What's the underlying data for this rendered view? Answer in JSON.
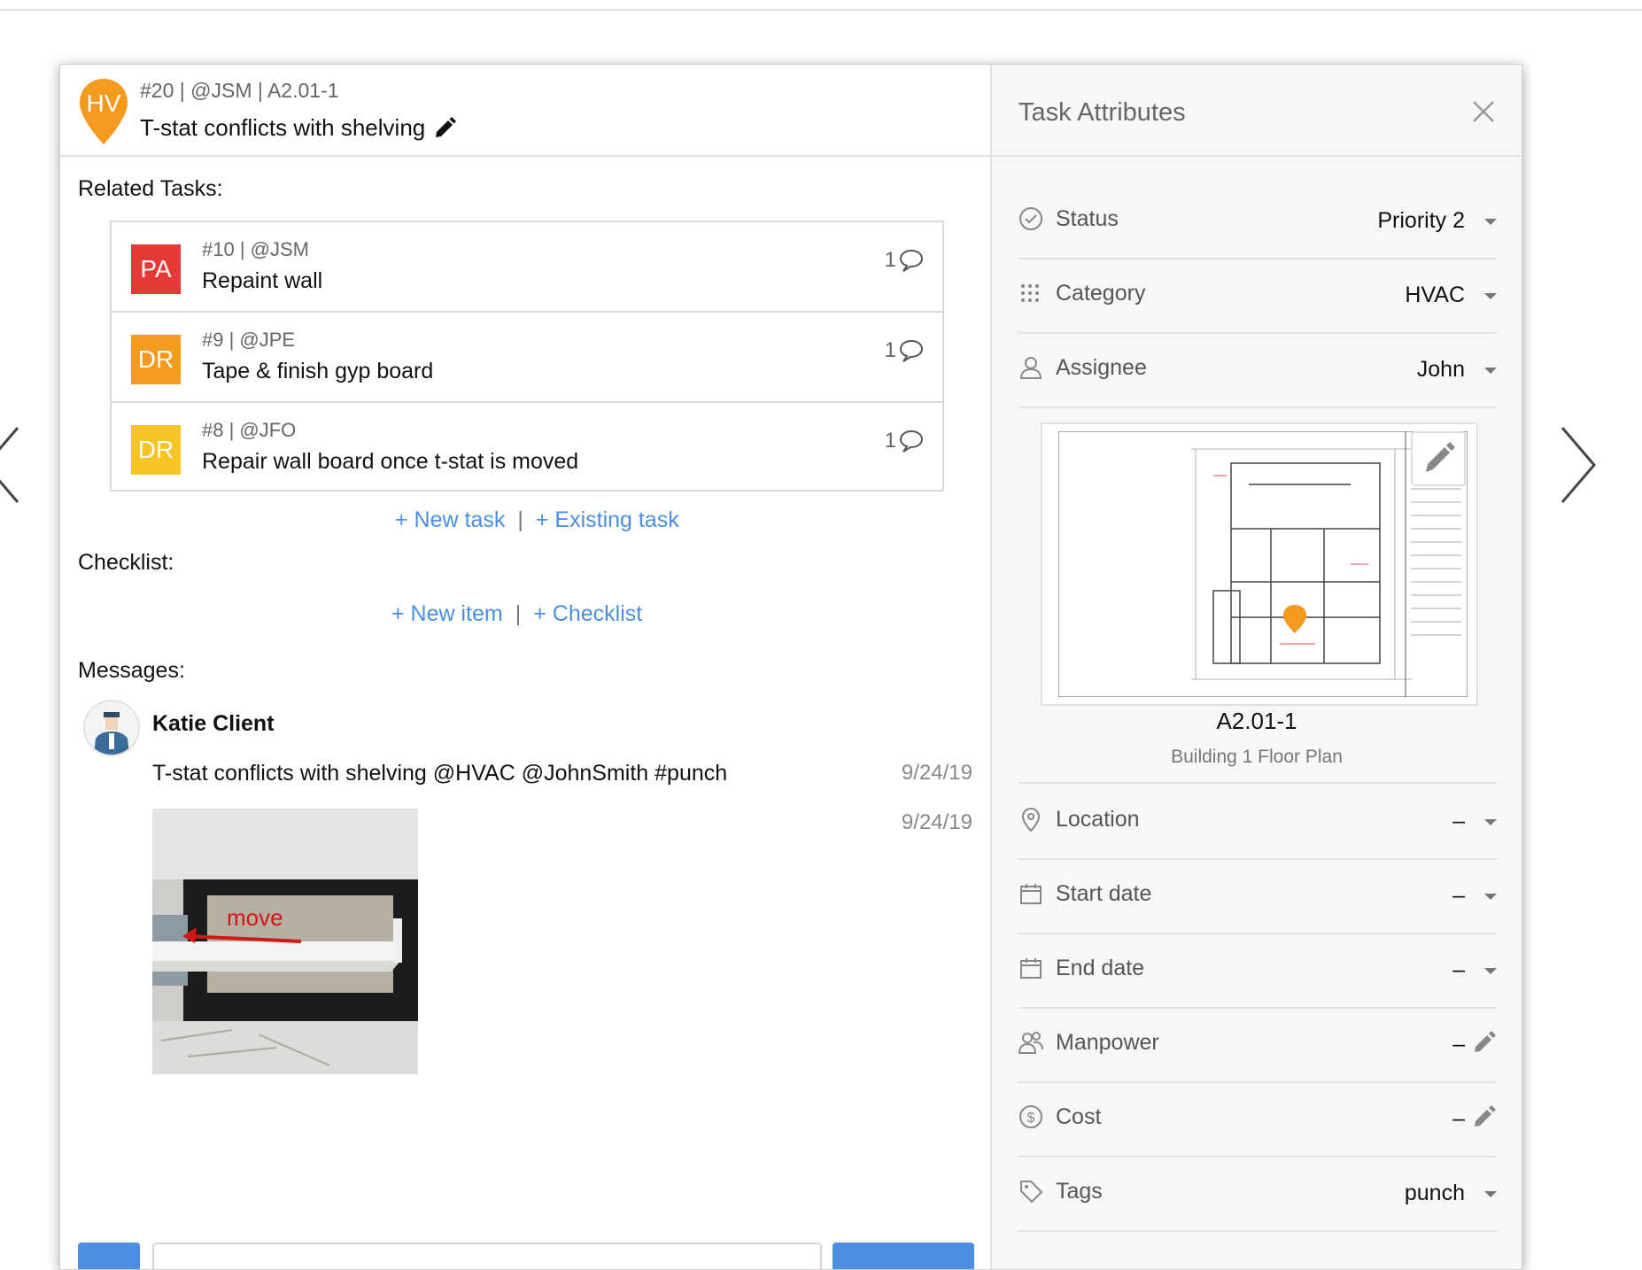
{
  "task": {
    "initials": "HV",
    "meta": "#20 | @JSM | A2.01-1",
    "title": "T-stat conflicts with shelving"
  },
  "labels": {
    "related_tasks": "Related Tasks:",
    "checklist": "Checklist:",
    "messages": "Messages:"
  },
  "related_tasks": [
    {
      "initials": "PA",
      "color": "#e53935",
      "meta": "#10 | @JSM",
      "title": "Repaint wall",
      "comments": "1"
    },
    {
      "initials": "DR",
      "color": "#f39a1f",
      "meta": "#9 | @JPE",
      "title": "Tape & finish gyp board",
      "comments": "1"
    },
    {
      "initials": "DR",
      "color": "#f7c325",
      "meta": "#8 | @JFO",
      "title": "Repair wall board once t-stat is moved",
      "comments": "1"
    }
  ],
  "task_links": {
    "new_task": "+ New task",
    "existing_task": "+ Existing task",
    "separator": "|"
  },
  "checklist_links": {
    "new_item": "+ New item",
    "checklist": "+ Checklist",
    "separator": "|"
  },
  "messages": [
    {
      "author": "Katie Client",
      "text": "T-stat conflicts with shelving @HVAC @JohnSmith #punch",
      "date": "9/24/19",
      "photo_date": "9/24/19",
      "photo_label": "move"
    }
  ],
  "attributes": {
    "title": "Task Attributes",
    "status": {
      "label": "Status",
      "value": "Priority 2"
    },
    "category": {
      "label": "Category",
      "value": "HVAC"
    },
    "assignee": {
      "label": "Assignee",
      "value": "John"
    },
    "sheet": {
      "name": "A2.01-1",
      "description": "Building 1 Floor Plan"
    },
    "location": {
      "label": "Location",
      "value": "–"
    },
    "start_date": {
      "label": "Start date",
      "value": "–"
    },
    "end_date": {
      "label": "End date",
      "value": "–"
    },
    "manpower": {
      "label": "Manpower",
      "value": "–"
    },
    "cost": {
      "label": "Cost",
      "value": "–"
    },
    "tags": {
      "label": "Tags",
      "value": "punch"
    }
  },
  "colors": {
    "accent": "#4a8fe2",
    "pin": "#f39a1f"
  }
}
